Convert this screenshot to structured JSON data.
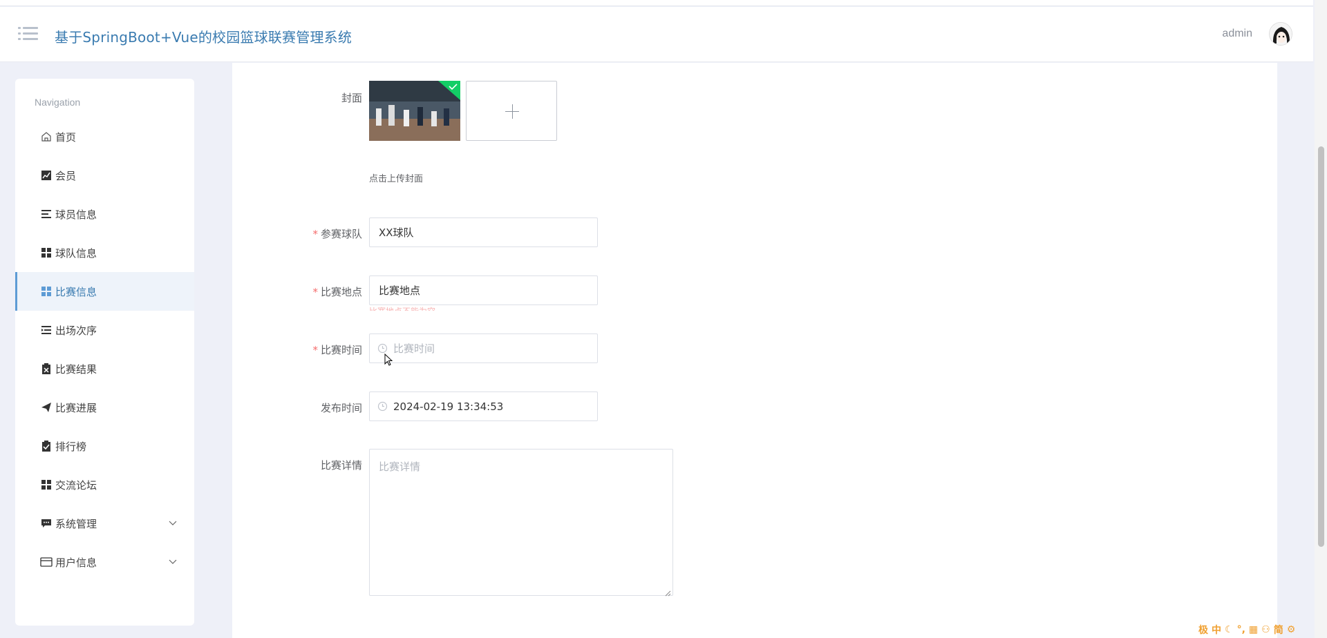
{
  "header": {
    "title": "基于SpringBoot+Vue的校园篮球联赛管理系统",
    "user": "admin"
  },
  "sidebar": {
    "title": "Navigation",
    "items": [
      {
        "label": "首页",
        "icon": "home-icon"
      },
      {
        "label": "会员",
        "icon": "chart-icon"
      },
      {
        "label": "球员信息",
        "icon": "list-icon"
      },
      {
        "label": "球队信息",
        "icon": "grid-icon"
      },
      {
        "label": "比赛信息",
        "icon": "grid-icon",
        "active": true
      },
      {
        "label": "出场次序",
        "icon": "indent-icon"
      },
      {
        "label": "比赛结果",
        "icon": "clipboard-x-icon"
      },
      {
        "label": "比赛进展",
        "icon": "send-icon"
      },
      {
        "label": "排行榜",
        "icon": "clipboard-check-icon"
      },
      {
        "label": "交流论坛",
        "icon": "grid-icon"
      },
      {
        "label": "系统管理",
        "icon": "chat-icon",
        "expandable": true
      },
      {
        "label": "用户信息",
        "icon": "card-icon",
        "expandable": true
      }
    ]
  },
  "form": {
    "cover_label": "封面",
    "upload_tip": "点击上传封面",
    "team_label": "参赛球队",
    "team_value": "XX球队",
    "venue_label": "比赛地点",
    "venue_value": "比赛地点",
    "venue_error": "比赛地点不能为空",
    "time_label": "比赛时间",
    "time_placeholder": "比赛时间",
    "publish_label": "发布时间",
    "publish_value": "2024-02-19 13:34:53",
    "detail_label": "比赛详情",
    "detail_placeholder": "比赛详情"
  },
  "ime": [
    "极",
    "中",
    "简"
  ],
  "colors": {
    "accent": "#3a7bb0",
    "required": "#f56c6c",
    "background": "#eef0f8"
  }
}
